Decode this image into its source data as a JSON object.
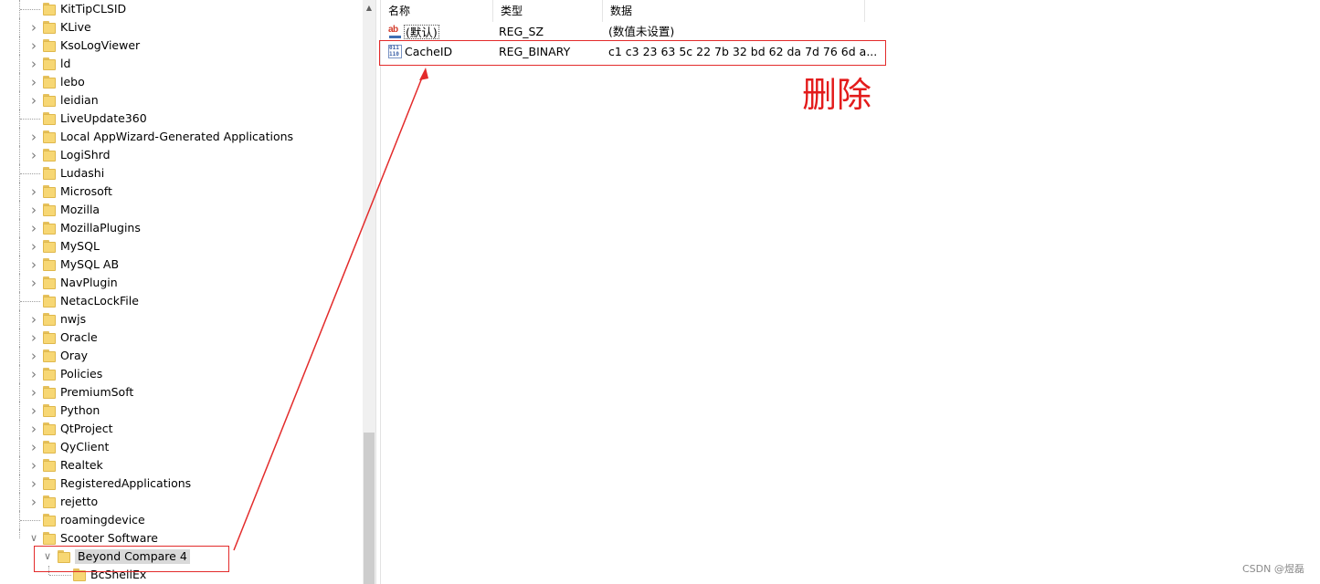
{
  "tree": {
    "items": [
      {
        "label": "KitTipCLSID",
        "expandable": false
      },
      {
        "label": "KLive",
        "expandable": true
      },
      {
        "label": "KsoLogViewer",
        "expandable": true
      },
      {
        "label": "ld",
        "expandable": true
      },
      {
        "label": "lebo",
        "expandable": true
      },
      {
        "label": "leidian",
        "expandable": true
      },
      {
        "label": "LiveUpdate360",
        "expandable": false
      },
      {
        "label": "Local AppWizard-Generated Applications",
        "expandable": true
      },
      {
        "label": "LogiShrd",
        "expandable": true
      },
      {
        "label": "Ludashi",
        "expandable": false
      },
      {
        "label": "Microsoft",
        "expandable": true
      },
      {
        "label": "Mozilla",
        "expandable": true
      },
      {
        "label": "MozillaPlugins",
        "expandable": true
      },
      {
        "label": "MySQL",
        "expandable": true
      },
      {
        "label": "MySQL AB",
        "expandable": true
      },
      {
        "label": "NavPlugin",
        "expandable": true
      },
      {
        "label": "NetacLockFile",
        "expandable": false
      },
      {
        "label": "nwjs",
        "expandable": true
      },
      {
        "label": "Oracle",
        "expandable": true
      },
      {
        "label": "Oray",
        "expandable": true
      },
      {
        "label": "Policies",
        "expandable": true
      },
      {
        "label": "PremiumSoft",
        "expandable": true
      },
      {
        "label": "Python",
        "expandable": true
      },
      {
        "label": "QtProject",
        "expandable": true
      },
      {
        "label": "QyClient",
        "expandable": true
      },
      {
        "label": "Realtek",
        "expandable": true
      },
      {
        "label": "RegisteredApplications",
        "expandable": true
      },
      {
        "label": "rejetto",
        "expandable": true
      },
      {
        "label": "roamingdevice",
        "expandable": false
      },
      {
        "label": "Scooter Software",
        "expandable": true,
        "expanded": true
      }
    ],
    "child": {
      "label": "Beyond Compare 4",
      "expanded": true,
      "selected": true
    },
    "grandchild": {
      "label": "BcShellEx"
    }
  },
  "values": {
    "columns": {
      "name": "名称",
      "type": "类型",
      "data": "数据"
    },
    "rows": [
      {
        "name": "(默认)",
        "type": "REG_SZ",
        "data": "(数值未设置)",
        "icon": "string-value-icon"
      },
      {
        "name": "CacheID",
        "type": "REG_BINARY",
        "data": "c1 c3 23 63 5c 22 7b 32 bd 62 da 7d 76 6d a...",
        "icon": "binary-value-icon"
      }
    ]
  },
  "icons": {
    "string_value": "ab",
    "binary_value": "011 110"
  },
  "annotation": {
    "delete_label": "删除",
    "color": "#e32b2b"
  },
  "watermark": "CSDN @煜磊"
}
